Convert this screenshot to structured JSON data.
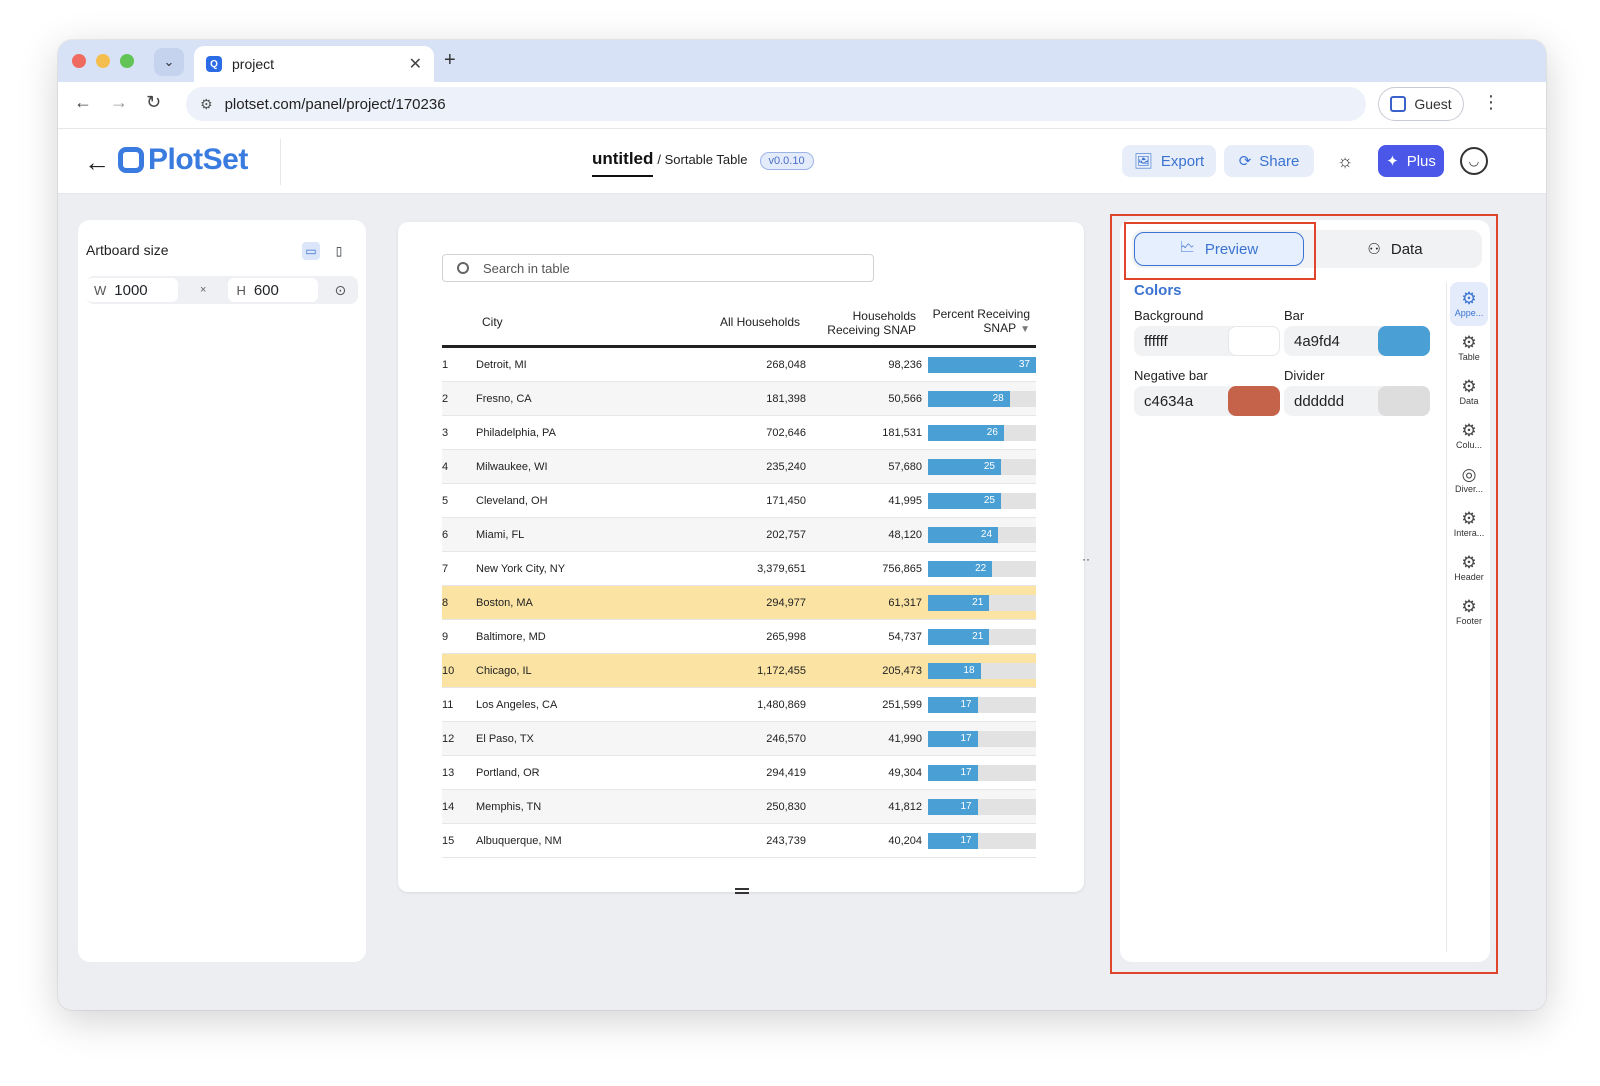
{
  "browser": {
    "tab_title": "project",
    "url": "plotset.com/panel/project/170236",
    "guest_label": "Guest"
  },
  "header": {
    "logo_text": "PlotSet",
    "project_title": "untitled",
    "project_type": "/ Sortable Table",
    "version": "v0.0.10",
    "export_label": "Export",
    "share_label": "Share",
    "plus_label": "Plus"
  },
  "artboard": {
    "title": "Artboard size",
    "width_label": "W",
    "width_value": "1000",
    "height_label": "H",
    "height_value": "600",
    "times": "×"
  },
  "table": {
    "search_placeholder": "Search in table",
    "headers": {
      "city": "City",
      "all": "All Households",
      "hh_line1": "Households",
      "hh_line2": "Receiving SNAP",
      "pct_line1": "Percent Receiving",
      "pct_line2": "SNAP"
    },
    "rows": [
      {
        "rank": "1",
        "city": "Detroit, MI",
        "all": "268,048",
        "hh": "98,236",
        "pct": 37,
        "highlight": false
      },
      {
        "rank": "2",
        "city": "Fresno, CA",
        "all": "181,398",
        "hh": "50,566",
        "pct": 28,
        "highlight": false
      },
      {
        "rank": "3",
        "city": "Philadelphia, PA",
        "all": "702,646",
        "hh": "181,531",
        "pct": 26,
        "highlight": false
      },
      {
        "rank": "4",
        "city": "Milwaukee, WI",
        "all": "235,240",
        "hh": "57,680",
        "pct": 25,
        "highlight": false
      },
      {
        "rank": "5",
        "city": "Cleveland, OH",
        "all": "171,450",
        "hh": "41,995",
        "pct": 25,
        "highlight": false
      },
      {
        "rank": "6",
        "city": "Miami, FL",
        "all": "202,757",
        "hh": "48,120",
        "pct": 24,
        "highlight": false
      },
      {
        "rank": "7",
        "city": "New York City, NY",
        "all": "3,379,651",
        "hh": "756,865",
        "pct": 22,
        "highlight": false
      },
      {
        "rank": "8",
        "city": "Boston, MA",
        "all": "294,977",
        "hh": "61,317",
        "pct": 21,
        "highlight": true
      },
      {
        "rank": "9",
        "city": "Baltimore, MD",
        "all": "265,998",
        "hh": "54,737",
        "pct": 21,
        "highlight": false
      },
      {
        "rank": "10",
        "city": "Chicago, IL",
        "all": "1,172,455",
        "hh": "205,473",
        "pct": 18,
        "highlight": true
      },
      {
        "rank": "11",
        "city": "Los Angeles, CA",
        "all": "1,480,869",
        "hh": "251,599",
        "pct": 17,
        "highlight": false
      },
      {
        "rank": "12",
        "city": "El Paso, TX",
        "all": "246,570",
        "hh": "41,990",
        "pct": 17,
        "highlight": false
      },
      {
        "rank": "13",
        "city": "Portland, OR",
        "all": "294,419",
        "hh": "49,304",
        "pct": 17,
        "highlight": false
      },
      {
        "rank": "14",
        "city": "Memphis, TN",
        "all": "250,830",
        "hh": "41,812",
        "pct": 17,
        "highlight": false
      },
      {
        "rank": "15",
        "city": "Albuquerque, NM",
        "all": "243,739",
        "hh": "40,204",
        "pct": 17,
        "highlight": false
      }
    ],
    "bar_max": 37,
    "bar_color": "#4a9fd4",
    "highlight_color": "#fbe3a4"
  },
  "rightpanel": {
    "preview_label": "Preview",
    "data_label": "Data",
    "colors_title": "Colors",
    "background_label": "Background",
    "background_value": "ffffff",
    "background_color": "#ffffff",
    "bar_label": "Bar",
    "bar_value": "4a9fd4",
    "bar_color": "#4a9fd4",
    "negative_label": "Negative bar",
    "negative_value": "c4634a",
    "negative_color": "#c4634a",
    "divider_label": "Divider",
    "divider_value": "dddddd",
    "divider_color": "#dddddd",
    "side_tabs": [
      "Appe...",
      "Table",
      "Data",
      "Colu...",
      "Diver...",
      "Intera...",
      "Header",
      "Footer"
    ]
  }
}
